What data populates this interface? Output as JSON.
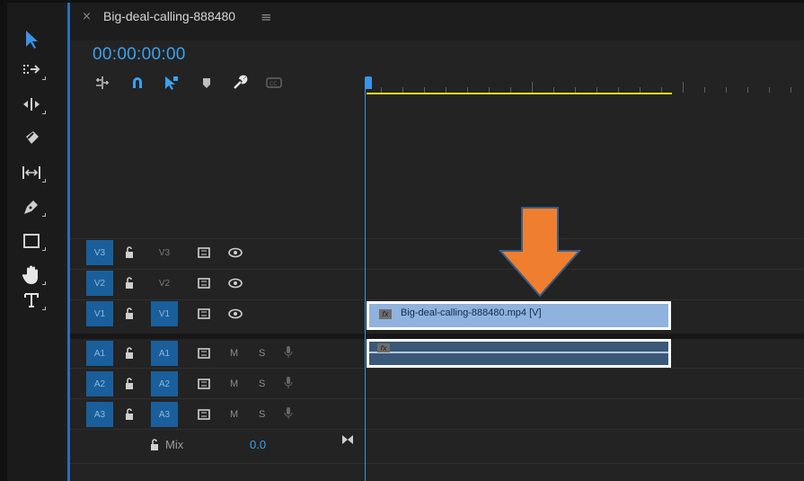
{
  "sequence": {
    "name": "Big-deal-calling-888480",
    "close_icon": "×",
    "menu_icon": "≡",
    "timecode": "00:00:00:00"
  },
  "tools": [
    "selection-tool",
    "track-select-forward-tool",
    "ripple-edit-tool",
    "razor-tool",
    "slip-tool",
    "pen-tool",
    "rectangle-tool",
    "hand-tool",
    "type-tool"
  ],
  "timeline_controls": [
    "insert-sequence-nest-icon",
    "snap-magnet-icon",
    "linked-selection-icon",
    "add-marker-icon",
    "settings-wrench-icon",
    "captions-icon"
  ],
  "video_tracks": [
    {
      "source": "V3",
      "target": "V3",
      "source_on": true,
      "target_on": false
    },
    {
      "source": "V2",
      "target": "V2",
      "source_on": true,
      "target_on": false
    },
    {
      "source": "V1",
      "target": "V1",
      "source_on": true,
      "target_on": true
    }
  ],
  "audio_tracks": [
    {
      "source": "A1",
      "target": "A1",
      "mute": "M",
      "solo": "S"
    },
    {
      "source": "A2",
      "target": "A2",
      "mute": "M",
      "solo": "S"
    },
    {
      "source": "A3",
      "target": "A3",
      "mute": "M",
      "solo": "S"
    }
  ],
  "mix": {
    "label": "Mix",
    "value": "0.0"
  },
  "clips": {
    "video": {
      "label": "Big-deal-calling-888480.mp4 [V]",
      "fx": "fx"
    },
    "audio": {
      "fx": "fx"
    }
  },
  "colors": {
    "accent": "#3ba1f0",
    "track_target": "#1a5f9b",
    "video_clip": "#8fb2de",
    "audio_clip": "#3a5878",
    "arrow": "#ef7f2e",
    "work_area": "#f2e600"
  }
}
